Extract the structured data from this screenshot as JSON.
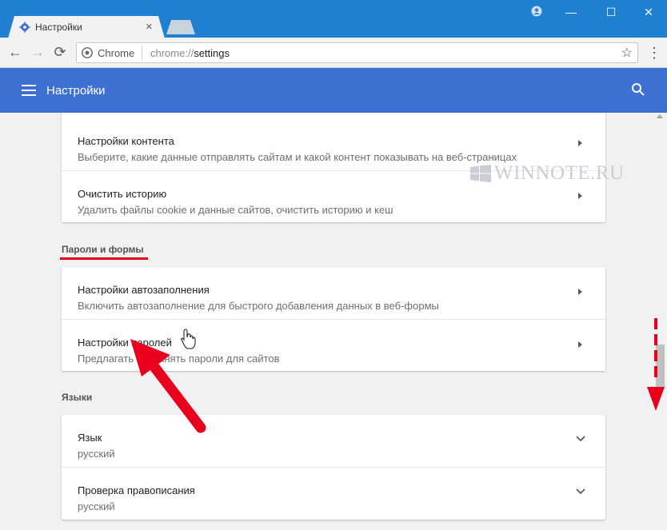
{
  "window": {
    "tab_title": "Настройки",
    "tab_close": "×",
    "minimize": "—",
    "maximize": "☐",
    "close": "✕"
  },
  "toolbar": {
    "back": "←",
    "forward": "→",
    "reload": "⟳",
    "omnibox_label": "Chrome",
    "url_scheme": "chrome://",
    "url_path": "settings",
    "star": "☆",
    "menu": "⋮"
  },
  "header": {
    "title": "Настройки"
  },
  "sections": {
    "privacy": {
      "rows": [
        {
          "title": "Настройки контента",
          "subtitle": "Выберите, какие данные отправлять сайтам и какой контент показывать на веб-страницах"
        },
        {
          "title": "Очистить историю",
          "subtitle": "Удалить файлы cookie и данные сайтов, очистить историю и кеш"
        }
      ]
    },
    "passwords": {
      "heading": "Пароли и формы",
      "rows": [
        {
          "title": "Настройки автозаполнения",
          "subtitle": "Включить автозаполнение для быстрого добавления данных в веб-формы"
        },
        {
          "title": "Настройки паролей",
          "subtitle": "Предлагать сохранять пароли для сайтов"
        }
      ]
    },
    "languages": {
      "heading": "Языки",
      "rows": [
        {
          "title": "Язык",
          "subtitle": "русский"
        },
        {
          "title": "Проверка правописания",
          "subtitle": "русский"
        }
      ]
    }
  },
  "watermark": {
    "text": "WINNOTE.RU"
  },
  "colors": {
    "titlebar": "#1f7fd0",
    "header": "#3d70d2",
    "annotation_red": "#e8001c"
  }
}
